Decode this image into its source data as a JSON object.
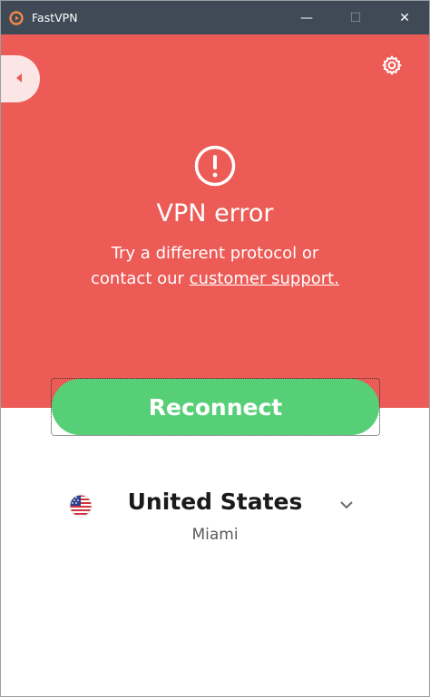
{
  "window": {
    "title": "FastVPN",
    "controls": {
      "minimize": "—",
      "maximize": "☐",
      "close": "✕"
    }
  },
  "error": {
    "title": "VPN error",
    "message_line1": "Try a different protocol or",
    "message_line2_prefix": "contact our ",
    "support_link": "customer support."
  },
  "actions": {
    "reconnect_label": "Reconnect"
  },
  "location": {
    "country": "United States",
    "city": "Miami",
    "flag": "us-flag-icon"
  },
  "icons": {
    "back": "back-arrow-icon",
    "settings": "gear-icon",
    "alert": "exclamation-circle-icon",
    "dropdown": "chevron-down-icon",
    "logo": "fastvpn-logo-icon"
  },
  "colors": {
    "titlebar": "#3f4a56",
    "error_bg": "#ec5b56",
    "back_tab": "#fbe6e5",
    "reconnect": "#57cf77",
    "logo": "#f0874a"
  }
}
